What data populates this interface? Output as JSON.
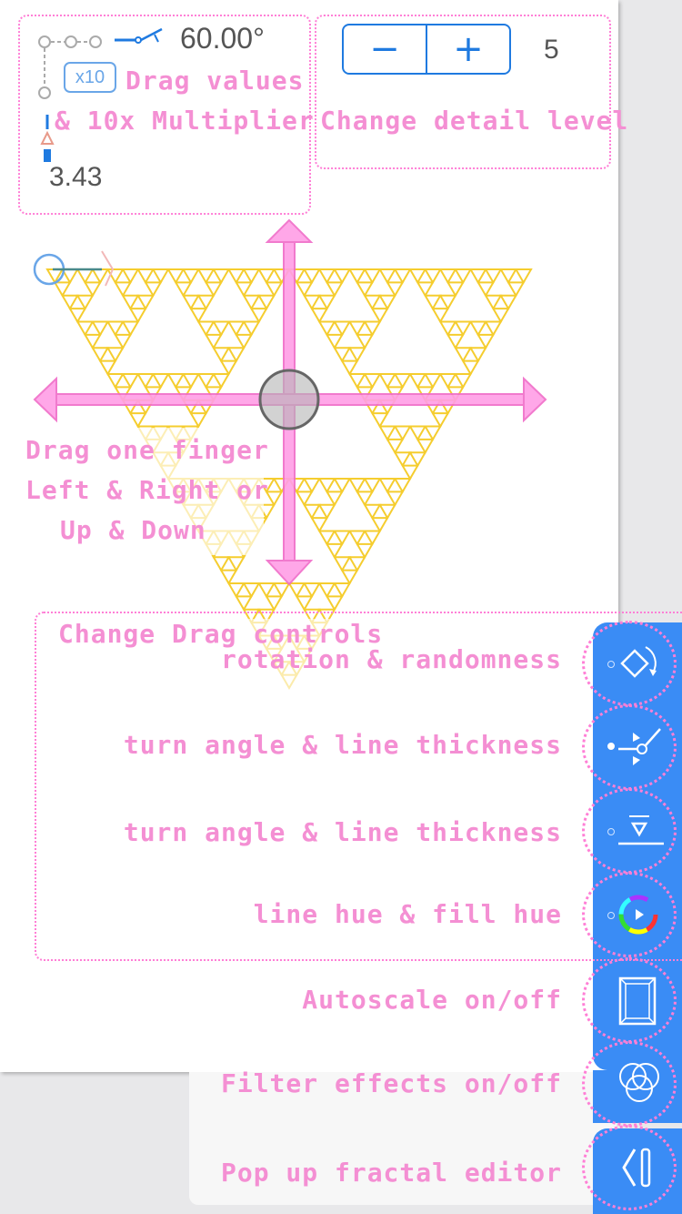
{
  "controls": {
    "angle_value": "60.00°",
    "multiplier_label": "x10",
    "drag_hint_line1": "Drag values",
    "drag_hint_line2": "& 10x Multiplier",
    "thickness_value": "3.43",
    "detail_minus": "−",
    "detail_plus": "+",
    "detail_value": "5",
    "detail_hint": "Change detail level"
  },
  "canvas_hint": {
    "line1": "Drag one finger",
    "line2": "Left & Right or",
    "line3": "Up & Down"
  },
  "drag_controls": {
    "title": "Change Drag controls",
    "items": [
      {
        "label": "rotation & randomness",
        "icon": "rotate-diamond-icon",
        "selected": false
      },
      {
        "label": "turn angle & line thickness",
        "icon": "turn-angle-icon",
        "selected": true
      },
      {
        "label": "turn angle & line thickness",
        "icon": "line-thickness-icon",
        "selected": false
      },
      {
        "label": "line hue & fill hue",
        "icon": "color-wheel-icon",
        "selected": false
      }
    ]
  },
  "toggles": {
    "autoscale": "Autoscale on/off",
    "filters": "Filter effects on/off",
    "editor": "Pop up fractal editor"
  },
  "colors": {
    "fractal": "#f5cd2f",
    "hint_pink": "#f48fd3",
    "accent_blue": "#1f7ae0",
    "toolbar_blue": "#3a8cf5"
  }
}
